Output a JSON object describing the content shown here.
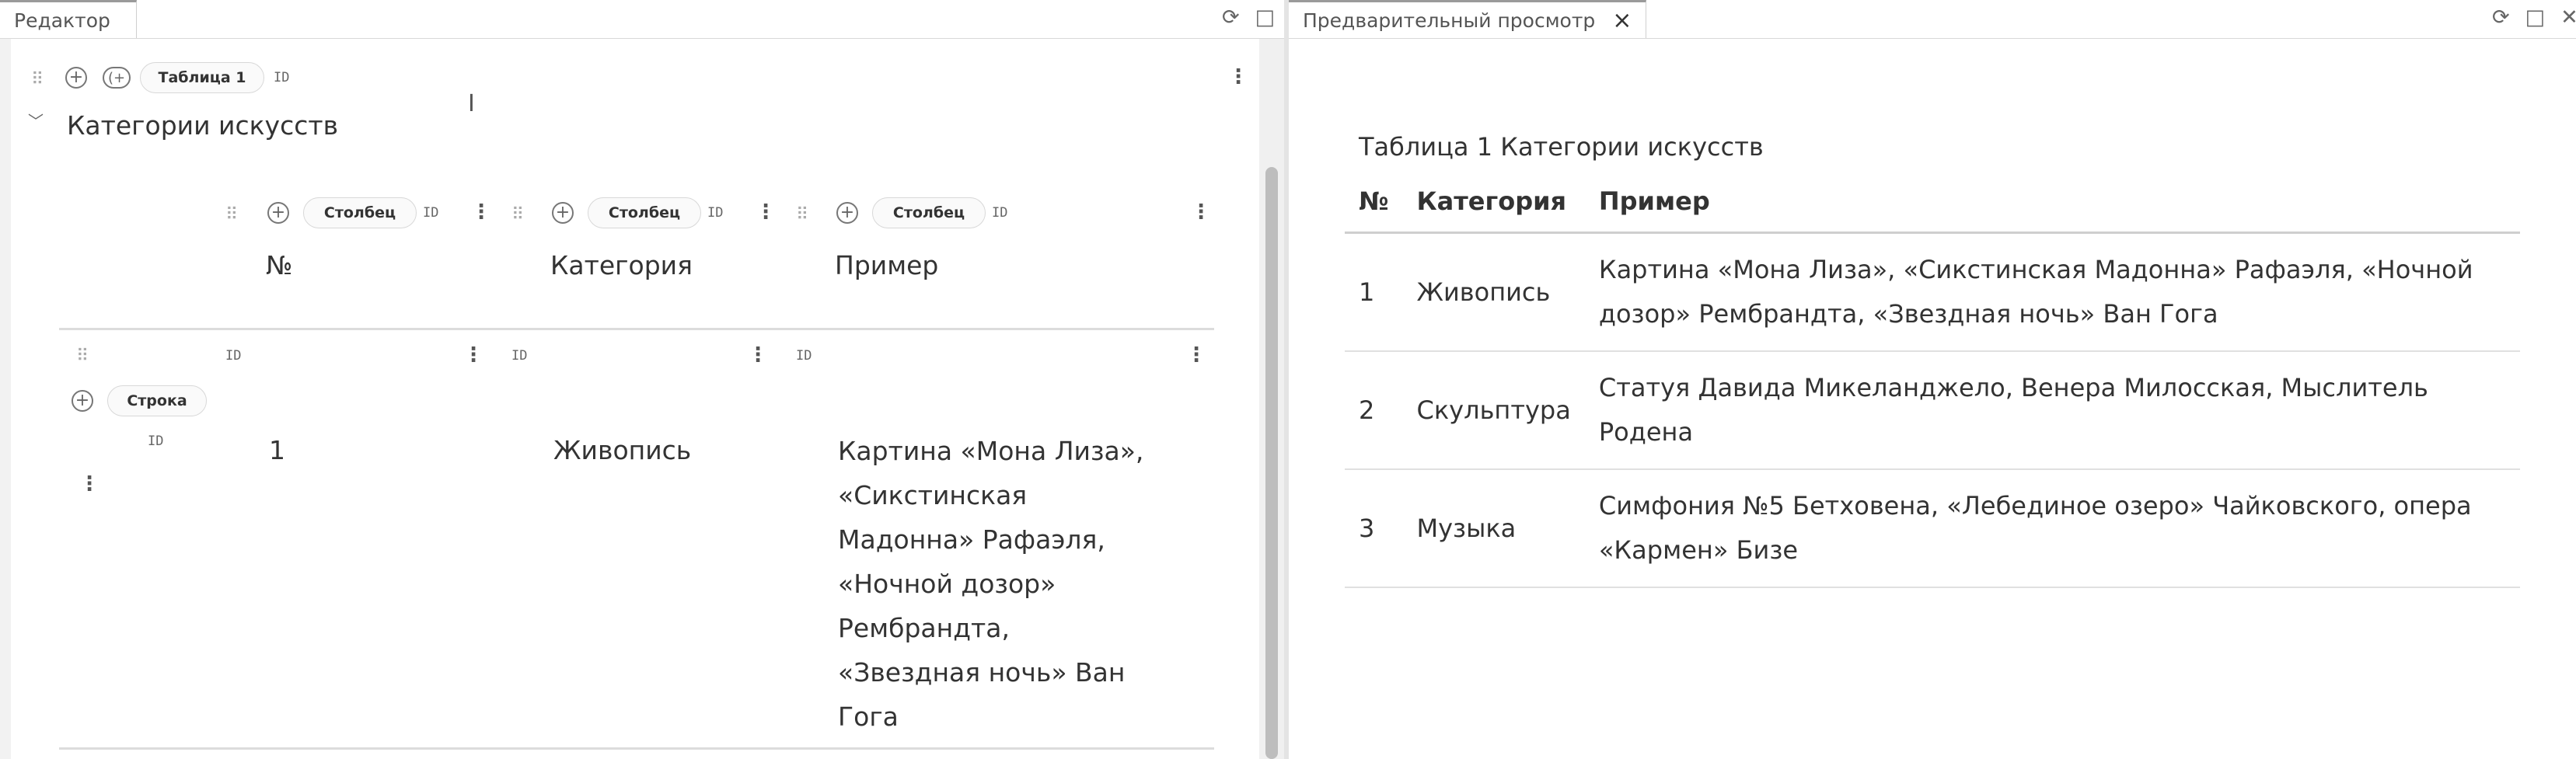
{
  "editor": {
    "tab_label": "Редактор",
    "table_pill": "Таблица 1",
    "id_label": "ID",
    "heading": "Категории искусств",
    "columns": [
      {
        "pill": "Столбец",
        "header": "№"
      },
      {
        "pill": "Столбец",
        "header": "Категория"
      },
      {
        "pill": "Столбец",
        "header": "Пример"
      }
    ],
    "row_pill": "Строка",
    "row": {
      "num": "1",
      "category": "Живопись",
      "example": "Картина «Мона Лиза», «Сикстинская Мадонна» Рафаэля, «Ночной дозор» Рембрандта, «Звездная ночь» Ван Гога"
    }
  },
  "preview": {
    "tab_label": "Предварительный просмотр",
    "caption": "Таблица 1 Категории искусств",
    "headers": [
      "№",
      "Категория",
      "Пример"
    ],
    "rows": [
      {
        "num": "1",
        "category": "Живопись",
        "example": "Картина «Мона Лиза», «Сикстинская Мадонна» Рафаэля, «Ночной дозор» Рембрандта, «Звездная ночь» Ван Гога"
      },
      {
        "num": "2",
        "category": "Скульптура",
        "example": "Статуя Давида Микеланджело, Венера Милосская, Мыслитель Родена"
      },
      {
        "num": "3",
        "category": "Музыка",
        "example": "Симфония №5 Бетховена, «Лебединое озеро» Чайковского, опера «Кармен» Бизе"
      }
    ]
  },
  "icons": {
    "refresh": "refresh-icon",
    "maximize": "maximize-icon",
    "close": "close-icon",
    "drag": "drag-handle-icon",
    "add": "add-icon",
    "more": "more-vertical-icon",
    "text_cursor": "text-cursor-icon"
  }
}
